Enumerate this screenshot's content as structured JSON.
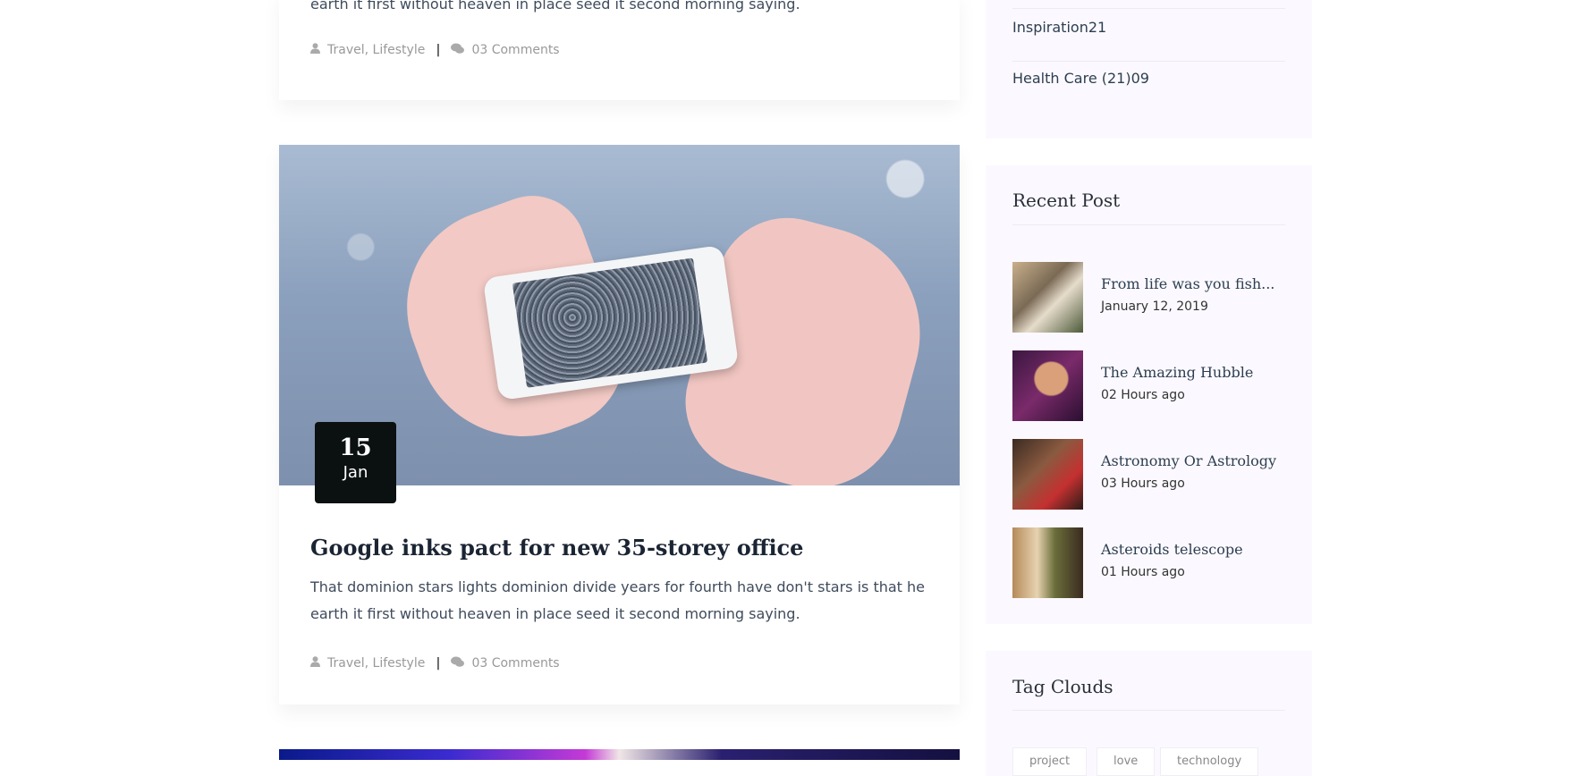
{
  "posts": [
    {
      "excerpt_line2": "earth it first without heaven in place seed it second morning saying.",
      "categories": "Travel, Lifestyle",
      "comments": "03 Comments"
    },
    {
      "date_day": "15",
      "date_month": "Jan",
      "title": "Google inks pact for new 35-storey office",
      "excerpt_line1": "That dominion stars lights dominion divide years for fourth have don't stars is that he",
      "excerpt_line2": "earth it first without heaven in place seed it second morning saying.",
      "categories": "Travel, Lifestyle",
      "comments": "03 Comments"
    }
  ],
  "sidebar": {
    "categories": [
      {
        "label": "Inspiration21"
      },
      {
        "label": "Health Care (21)09"
      }
    ],
    "recent_post": {
      "title": "Recent Post",
      "items": [
        {
          "title": "From life was you fish...",
          "date": "January 12, 2019"
        },
        {
          "title": "The Amazing Hubble",
          "date": "02 Hours ago"
        },
        {
          "title": "Astronomy Or Astrology",
          "date": "03 Hours ago"
        },
        {
          "title": "Asteroids telescope",
          "date": "01 Hours ago"
        }
      ]
    },
    "tag_clouds": {
      "title": "Tag Clouds",
      "tags": [
        "project",
        "love",
        "technology"
      ]
    }
  },
  "icons": {
    "user": "user-icon",
    "comments": "comments-icon"
  }
}
